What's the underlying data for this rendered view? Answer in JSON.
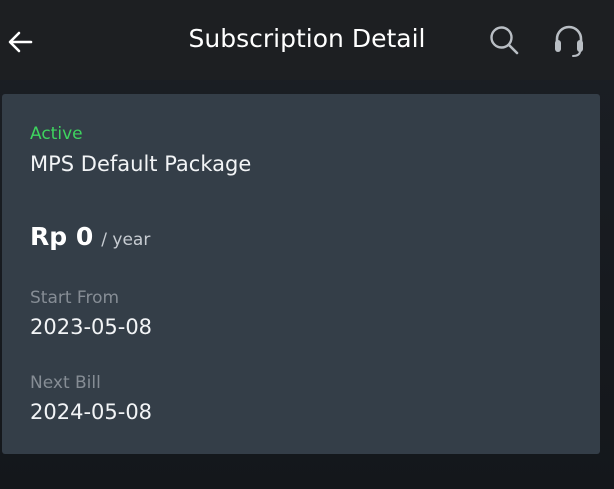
{
  "header": {
    "title": "Subscription Detail",
    "back_icon": "arrow-left-icon",
    "search_icon": "search-icon",
    "support_icon": "headset-icon"
  },
  "subscription": {
    "status": "Active",
    "package_name": "MPS Default Package",
    "price": "Rp 0",
    "period": "/ year",
    "start_label": "Start From",
    "start_date": "2023-05-08",
    "next_bill_label": "Next Bill",
    "next_bill_date": "2024-05-08"
  },
  "colors": {
    "background": "#1b1f25",
    "header_bg": "#1d1f22",
    "card_bg": "#343e48",
    "status_active": "#3ed45f",
    "label_muted": "#868d95"
  }
}
